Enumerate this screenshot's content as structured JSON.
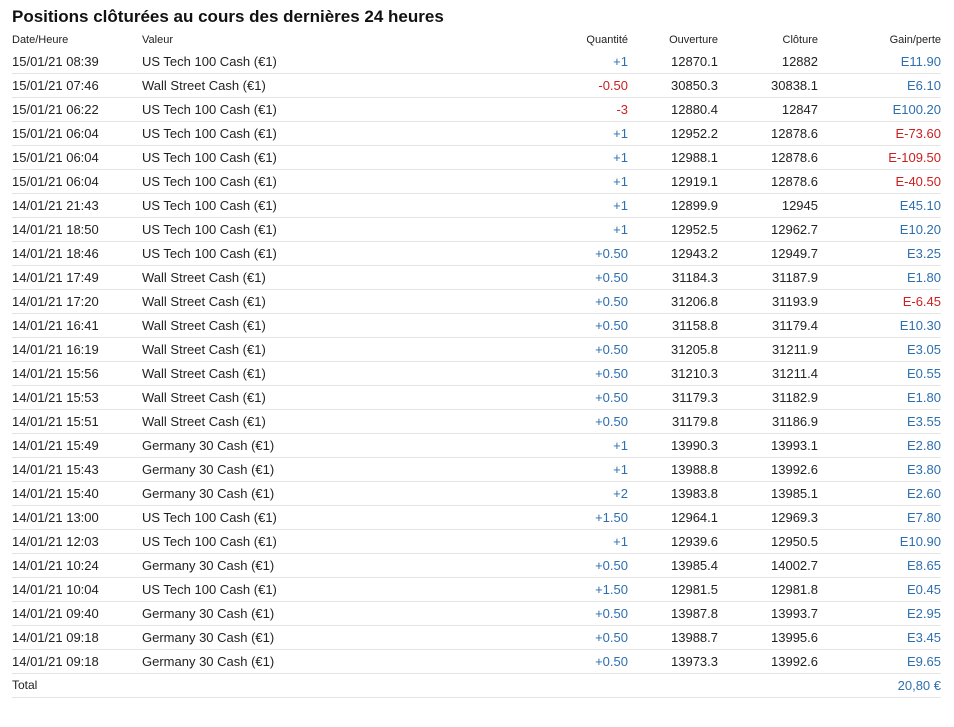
{
  "title": "Positions clôturées au cours des dernières 24 heures",
  "columns": {
    "date": "Date/Heure",
    "name": "Valeur",
    "qty": "Quantité",
    "open": "Ouverture",
    "close": "Clôture",
    "pl": "Gain/perte"
  },
  "colors": {
    "positive": "#2e6fb0",
    "negative": "#cc1f1f"
  },
  "rows": [
    {
      "date": "15/01/21 08:39",
      "name": "US Tech 100 Cash (€1)",
      "qty": "+1",
      "open": "12870.1",
      "close": "12882",
      "pl": "E11.90",
      "qty_sign": "pos",
      "pl_sign": "pos"
    },
    {
      "date": "15/01/21 07:46",
      "name": "Wall Street Cash (€1)",
      "qty": "-0.50",
      "open": "30850.3",
      "close": "30838.1",
      "pl": "E6.10",
      "qty_sign": "neg",
      "pl_sign": "pos"
    },
    {
      "date": "15/01/21 06:22",
      "name": "US Tech 100 Cash (€1)",
      "qty": "-3",
      "open": "12880.4",
      "close": "12847",
      "pl": "E100.20",
      "qty_sign": "neg",
      "pl_sign": "pos"
    },
    {
      "date": "15/01/21 06:04",
      "name": "US Tech 100 Cash (€1)",
      "qty": "+1",
      "open": "12952.2",
      "close": "12878.6",
      "pl": "E-73.60",
      "qty_sign": "pos",
      "pl_sign": "neg"
    },
    {
      "date": "15/01/21 06:04",
      "name": "US Tech 100 Cash (€1)",
      "qty": "+1",
      "open": "12988.1",
      "close": "12878.6",
      "pl": "E-109.50",
      "qty_sign": "pos",
      "pl_sign": "neg"
    },
    {
      "date": "15/01/21 06:04",
      "name": "US Tech 100 Cash (€1)",
      "qty": "+1",
      "open": "12919.1",
      "close": "12878.6",
      "pl": "E-40.50",
      "qty_sign": "pos",
      "pl_sign": "neg"
    },
    {
      "date": "14/01/21 21:43",
      "name": "US Tech 100 Cash (€1)",
      "qty": "+1",
      "open": "12899.9",
      "close": "12945",
      "pl": "E45.10",
      "qty_sign": "pos",
      "pl_sign": "pos"
    },
    {
      "date": "14/01/21 18:50",
      "name": "US Tech 100 Cash (€1)",
      "qty": "+1",
      "open": "12952.5",
      "close": "12962.7",
      "pl": "E10.20",
      "qty_sign": "pos",
      "pl_sign": "pos"
    },
    {
      "date": "14/01/21 18:46",
      "name": "US Tech 100 Cash (€1)",
      "qty": "+0.50",
      "open": "12943.2",
      "close": "12949.7",
      "pl": "E3.25",
      "qty_sign": "pos",
      "pl_sign": "pos"
    },
    {
      "date": "14/01/21 17:49",
      "name": "Wall Street Cash (€1)",
      "qty": "+0.50",
      "open": "31184.3",
      "close": "31187.9",
      "pl": "E1.80",
      "qty_sign": "pos",
      "pl_sign": "pos"
    },
    {
      "date": "14/01/21 17:20",
      "name": "Wall Street Cash (€1)",
      "qty": "+0.50",
      "open": "31206.8",
      "close": "31193.9",
      "pl": "E-6.45",
      "qty_sign": "pos",
      "pl_sign": "neg"
    },
    {
      "date": "14/01/21 16:41",
      "name": "Wall Street Cash (€1)",
      "qty": "+0.50",
      "open": "31158.8",
      "close": "31179.4",
      "pl": "E10.30",
      "qty_sign": "pos",
      "pl_sign": "pos"
    },
    {
      "date": "14/01/21 16:19",
      "name": "Wall Street Cash (€1)",
      "qty": "+0.50",
      "open": "31205.8",
      "close": "31211.9",
      "pl": "E3.05",
      "qty_sign": "pos",
      "pl_sign": "pos"
    },
    {
      "date": "14/01/21 15:56",
      "name": "Wall Street Cash (€1)",
      "qty": "+0.50",
      "open": "31210.3",
      "close": "31211.4",
      "pl": "E0.55",
      "qty_sign": "pos",
      "pl_sign": "pos"
    },
    {
      "date": "14/01/21 15:53",
      "name": "Wall Street Cash (€1)",
      "qty": "+0.50",
      "open": "31179.3",
      "close": "31182.9",
      "pl": "E1.80",
      "qty_sign": "pos",
      "pl_sign": "pos"
    },
    {
      "date": "14/01/21 15:51",
      "name": "Wall Street Cash (€1)",
      "qty": "+0.50",
      "open": "31179.8",
      "close": "31186.9",
      "pl": "E3.55",
      "qty_sign": "pos",
      "pl_sign": "pos"
    },
    {
      "date": "14/01/21 15:49",
      "name": "Germany 30 Cash (€1)",
      "qty": "+1",
      "open": "13990.3",
      "close": "13993.1",
      "pl": "E2.80",
      "qty_sign": "pos",
      "pl_sign": "pos"
    },
    {
      "date": "14/01/21 15:43",
      "name": "Germany 30 Cash (€1)",
      "qty": "+1",
      "open": "13988.8",
      "close": "13992.6",
      "pl": "E3.80",
      "qty_sign": "pos",
      "pl_sign": "pos"
    },
    {
      "date": "14/01/21 15:40",
      "name": "Germany 30 Cash (€1)",
      "qty": "+2",
      "open": "13983.8",
      "close": "13985.1",
      "pl": "E2.60",
      "qty_sign": "pos",
      "pl_sign": "pos"
    },
    {
      "date": "14/01/21 13:00",
      "name": "US Tech 100 Cash (€1)",
      "qty": "+1.50",
      "open": "12964.1",
      "close": "12969.3",
      "pl": "E7.80",
      "qty_sign": "pos",
      "pl_sign": "pos"
    },
    {
      "date": "14/01/21 12:03",
      "name": "US Tech 100 Cash (€1)",
      "qty": "+1",
      "open": "12939.6",
      "close": "12950.5",
      "pl": "E10.90",
      "qty_sign": "pos",
      "pl_sign": "pos"
    },
    {
      "date": "14/01/21 10:24",
      "name": "Germany 30 Cash (€1)",
      "qty": "+0.50",
      "open": "13985.4",
      "close": "14002.7",
      "pl": "E8.65",
      "qty_sign": "pos",
      "pl_sign": "pos"
    },
    {
      "date": "14/01/21 10:04",
      "name": "US Tech 100 Cash (€1)",
      "qty": "+1.50",
      "open": "12981.5",
      "close": "12981.8",
      "pl": "E0.45",
      "qty_sign": "pos",
      "pl_sign": "pos"
    },
    {
      "date": "14/01/21 09:40",
      "name": "Germany 30 Cash (€1)",
      "qty": "+0.50",
      "open": "13987.8",
      "close": "13993.7",
      "pl": "E2.95",
      "qty_sign": "pos",
      "pl_sign": "pos"
    },
    {
      "date": "14/01/21 09:18",
      "name": "Germany 30 Cash (€1)",
      "qty": "+0.50",
      "open": "13988.7",
      "close": "13995.6",
      "pl": "E3.45",
      "qty_sign": "pos",
      "pl_sign": "pos"
    },
    {
      "date": "14/01/21 09:18",
      "name": "Germany 30 Cash (€1)",
      "qty": "+0.50",
      "open": "13973.3",
      "close": "13992.6",
      "pl": "E9.65",
      "qty_sign": "pos",
      "pl_sign": "pos"
    }
  ],
  "total": {
    "label": "Total",
    "value": "20,80 €"
  }
}
